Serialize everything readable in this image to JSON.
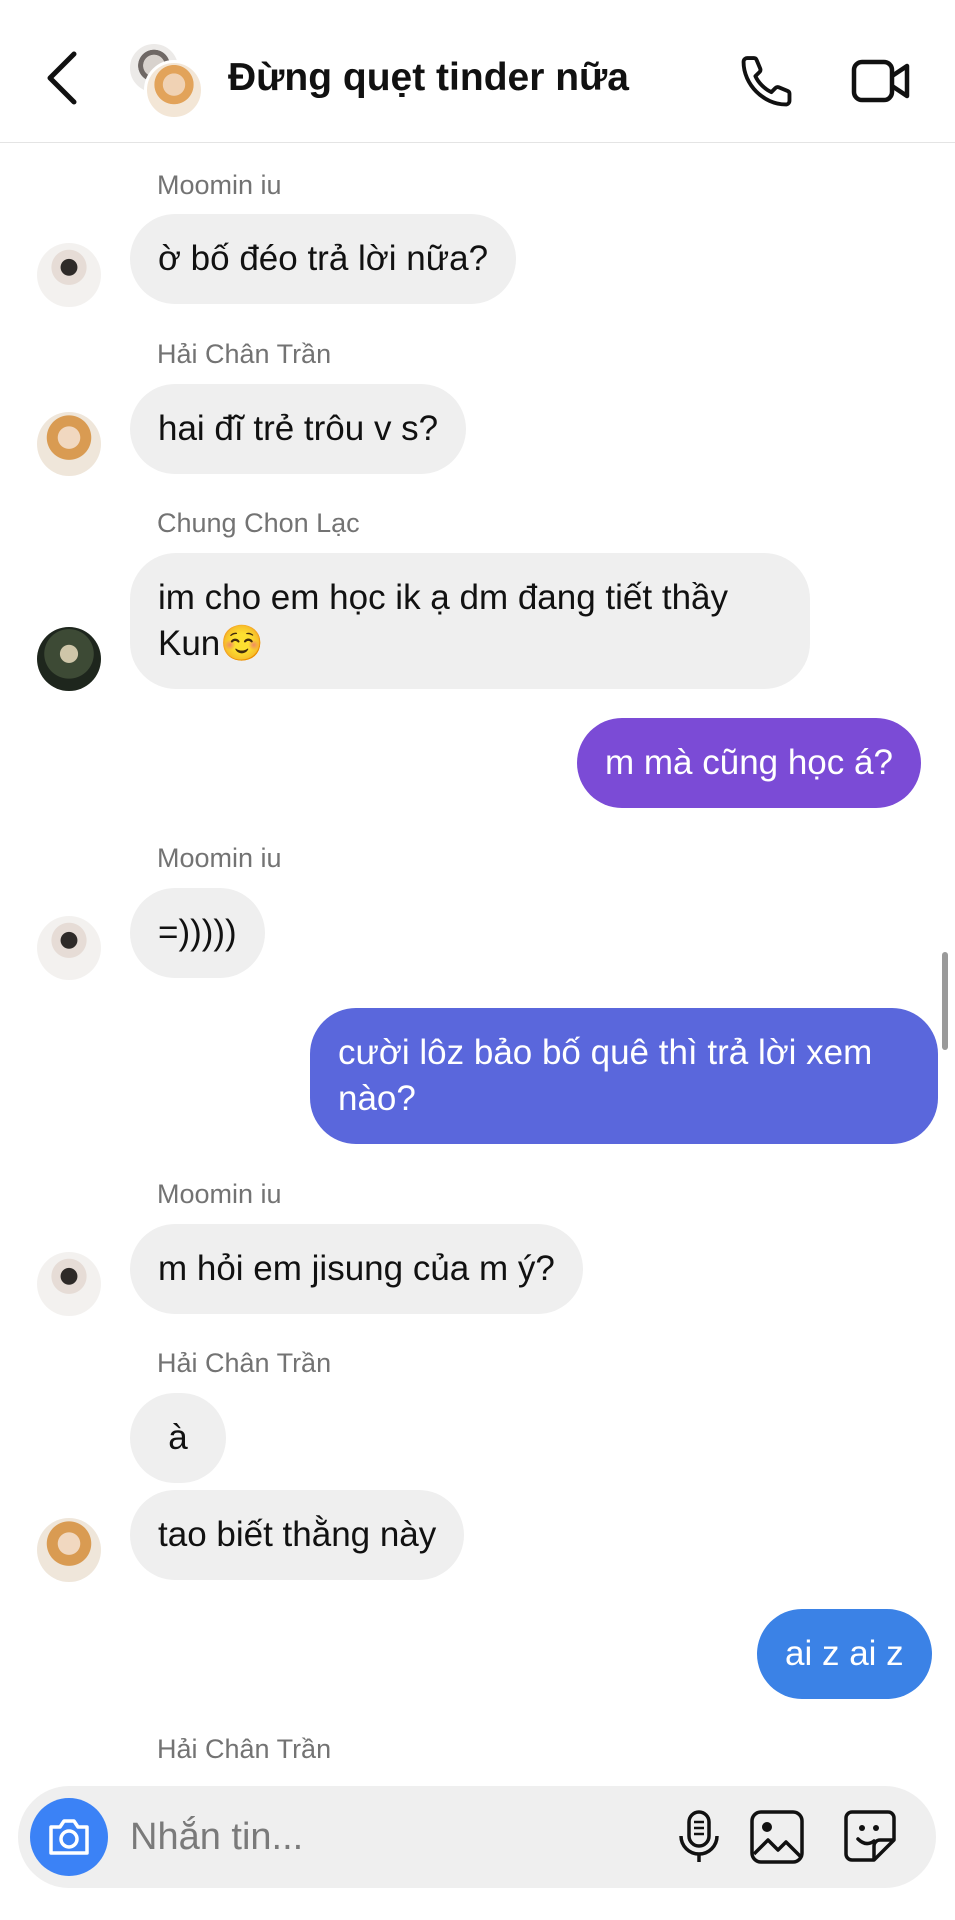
{
  "header": {
    "title": "Đừng quẹt tinder nữa"
  },
  "messages": [
    {
      "type": "in",
      "sender": "Moomin iu",
      "text": "ờ bố đéo trả lời nữa?"
    },
    {
      "type": "in",
      "sender": "Hải Chân Trần",
      "text": "hai đĩ trẻ trôu v s?"
    },
    {
      "type": "in",
      "sender": "Chung Chon Lạc",
      "text": "im cho em học ik ạ dm đang tiết thầy Kun☺️"
    },
    {
      "type": "out",
      "text": "m mà cũng học á?",
      "color": "#7b4bd6"
    },
    {
      "type": "in",
      "sender": "Moomin iu",
      "text": "=)))))"
    },
    {
      "type": "out",
      "text": "cười lôz bảo bố quê thì trả lời xem nào?",
      "color": "#5a67dc"
    },
    {
      "type": "in",
      "sender": "Moomin iu",
      "text": "m hỏi em jisung của m ý?"
    },
    {
      "type": "in",
      "sender": "Hải Chân Trần",
      "text": "à"
    },
    {
      "type": "in",
      "text": "tao biết thằng này"
    },
    {
      "type": "out",
      "text": "ai z ai z",
      "color": "#3b82e6"
    },
    {
      "type": "in",
      "sender": "Hải Chân Trần",
      "text": ""
    }
  ],
  "composer": {
    "placeholder": "Nhắn tin..."
  },
  "colors": {
    "incoming_bubble": "#efefef",
    "camera_button": "#3b82f6"
  }
}
